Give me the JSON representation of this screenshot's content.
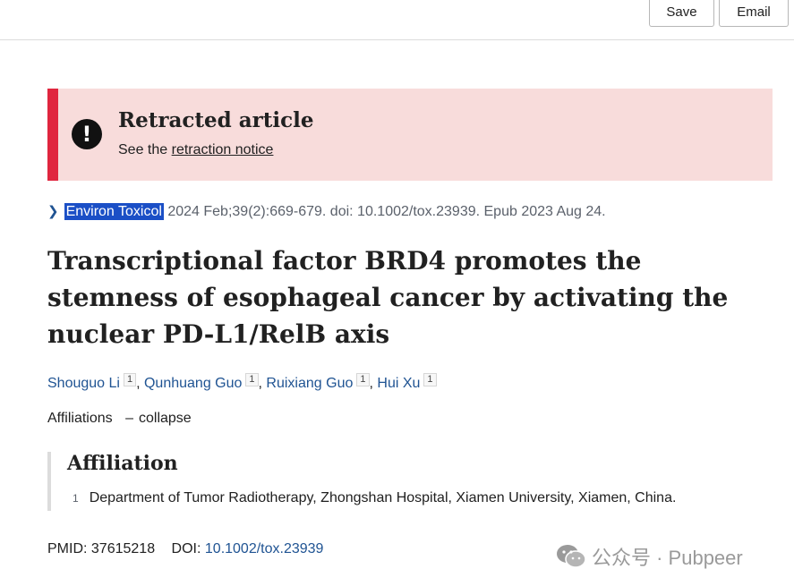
{
  "toolbar": {
    "save_label": "Save",
    "email_label": "Email"
  },
  "retraction": {
    "icon": "exclamation-icon",
    "title": "Retracted article",
    "notice_prefix": "See the",
    "notice_link": "retraction notice",
    "accent_color": "#e0263f",
    "bg_color": "#f8dcdb"
  },
  "citation": {
    "journal": "Environ Toxicol",
    "details": "2024 Feb;39(2):669-679. doi: 10.1002/tox.23939. Epub 2023 Aug 24."
  },
  "article": {
    "title": "Transcriptional factor BRD4 promotes the stemness of esophageal cancer by activating the nuclear PD-L1/RelB axis"
  },
  "authors": [
    {
      "name": "Shouguo Li",
      "aff": "1"
    },
    {
      "name": "Qunhuang Guo",
      "aff": "1"
    },
    {
      "name": "Ruixiang Guo",
      "aff": "1"
    },
    {
      "name": "Hui Xu",
      "aff": "1"
    }
  ],
  "affiliations": {
    "label": "Affiliations",
    "toggle_dash": "–",
    "toggle_label": "collapse",
    "heading": "Affiliation",
    "items": [
      {
        "num": "1",
        "text": "Department of Tumor Radiotherapy, Zhongshan Hospital, Xiamen University, Xiamen, China."
      }
    ]
  },
  "identifiers": {
    "pmid_label": "PMID:",
    "pmid": "37615218",
    "doi_label": "DOI:",
    "doi": "10.1002/tox.23939"
  },
  "watermark": {
    "text": "公众号 · Pubpeer",
    "icon": "wechat-icon"
  }
}
